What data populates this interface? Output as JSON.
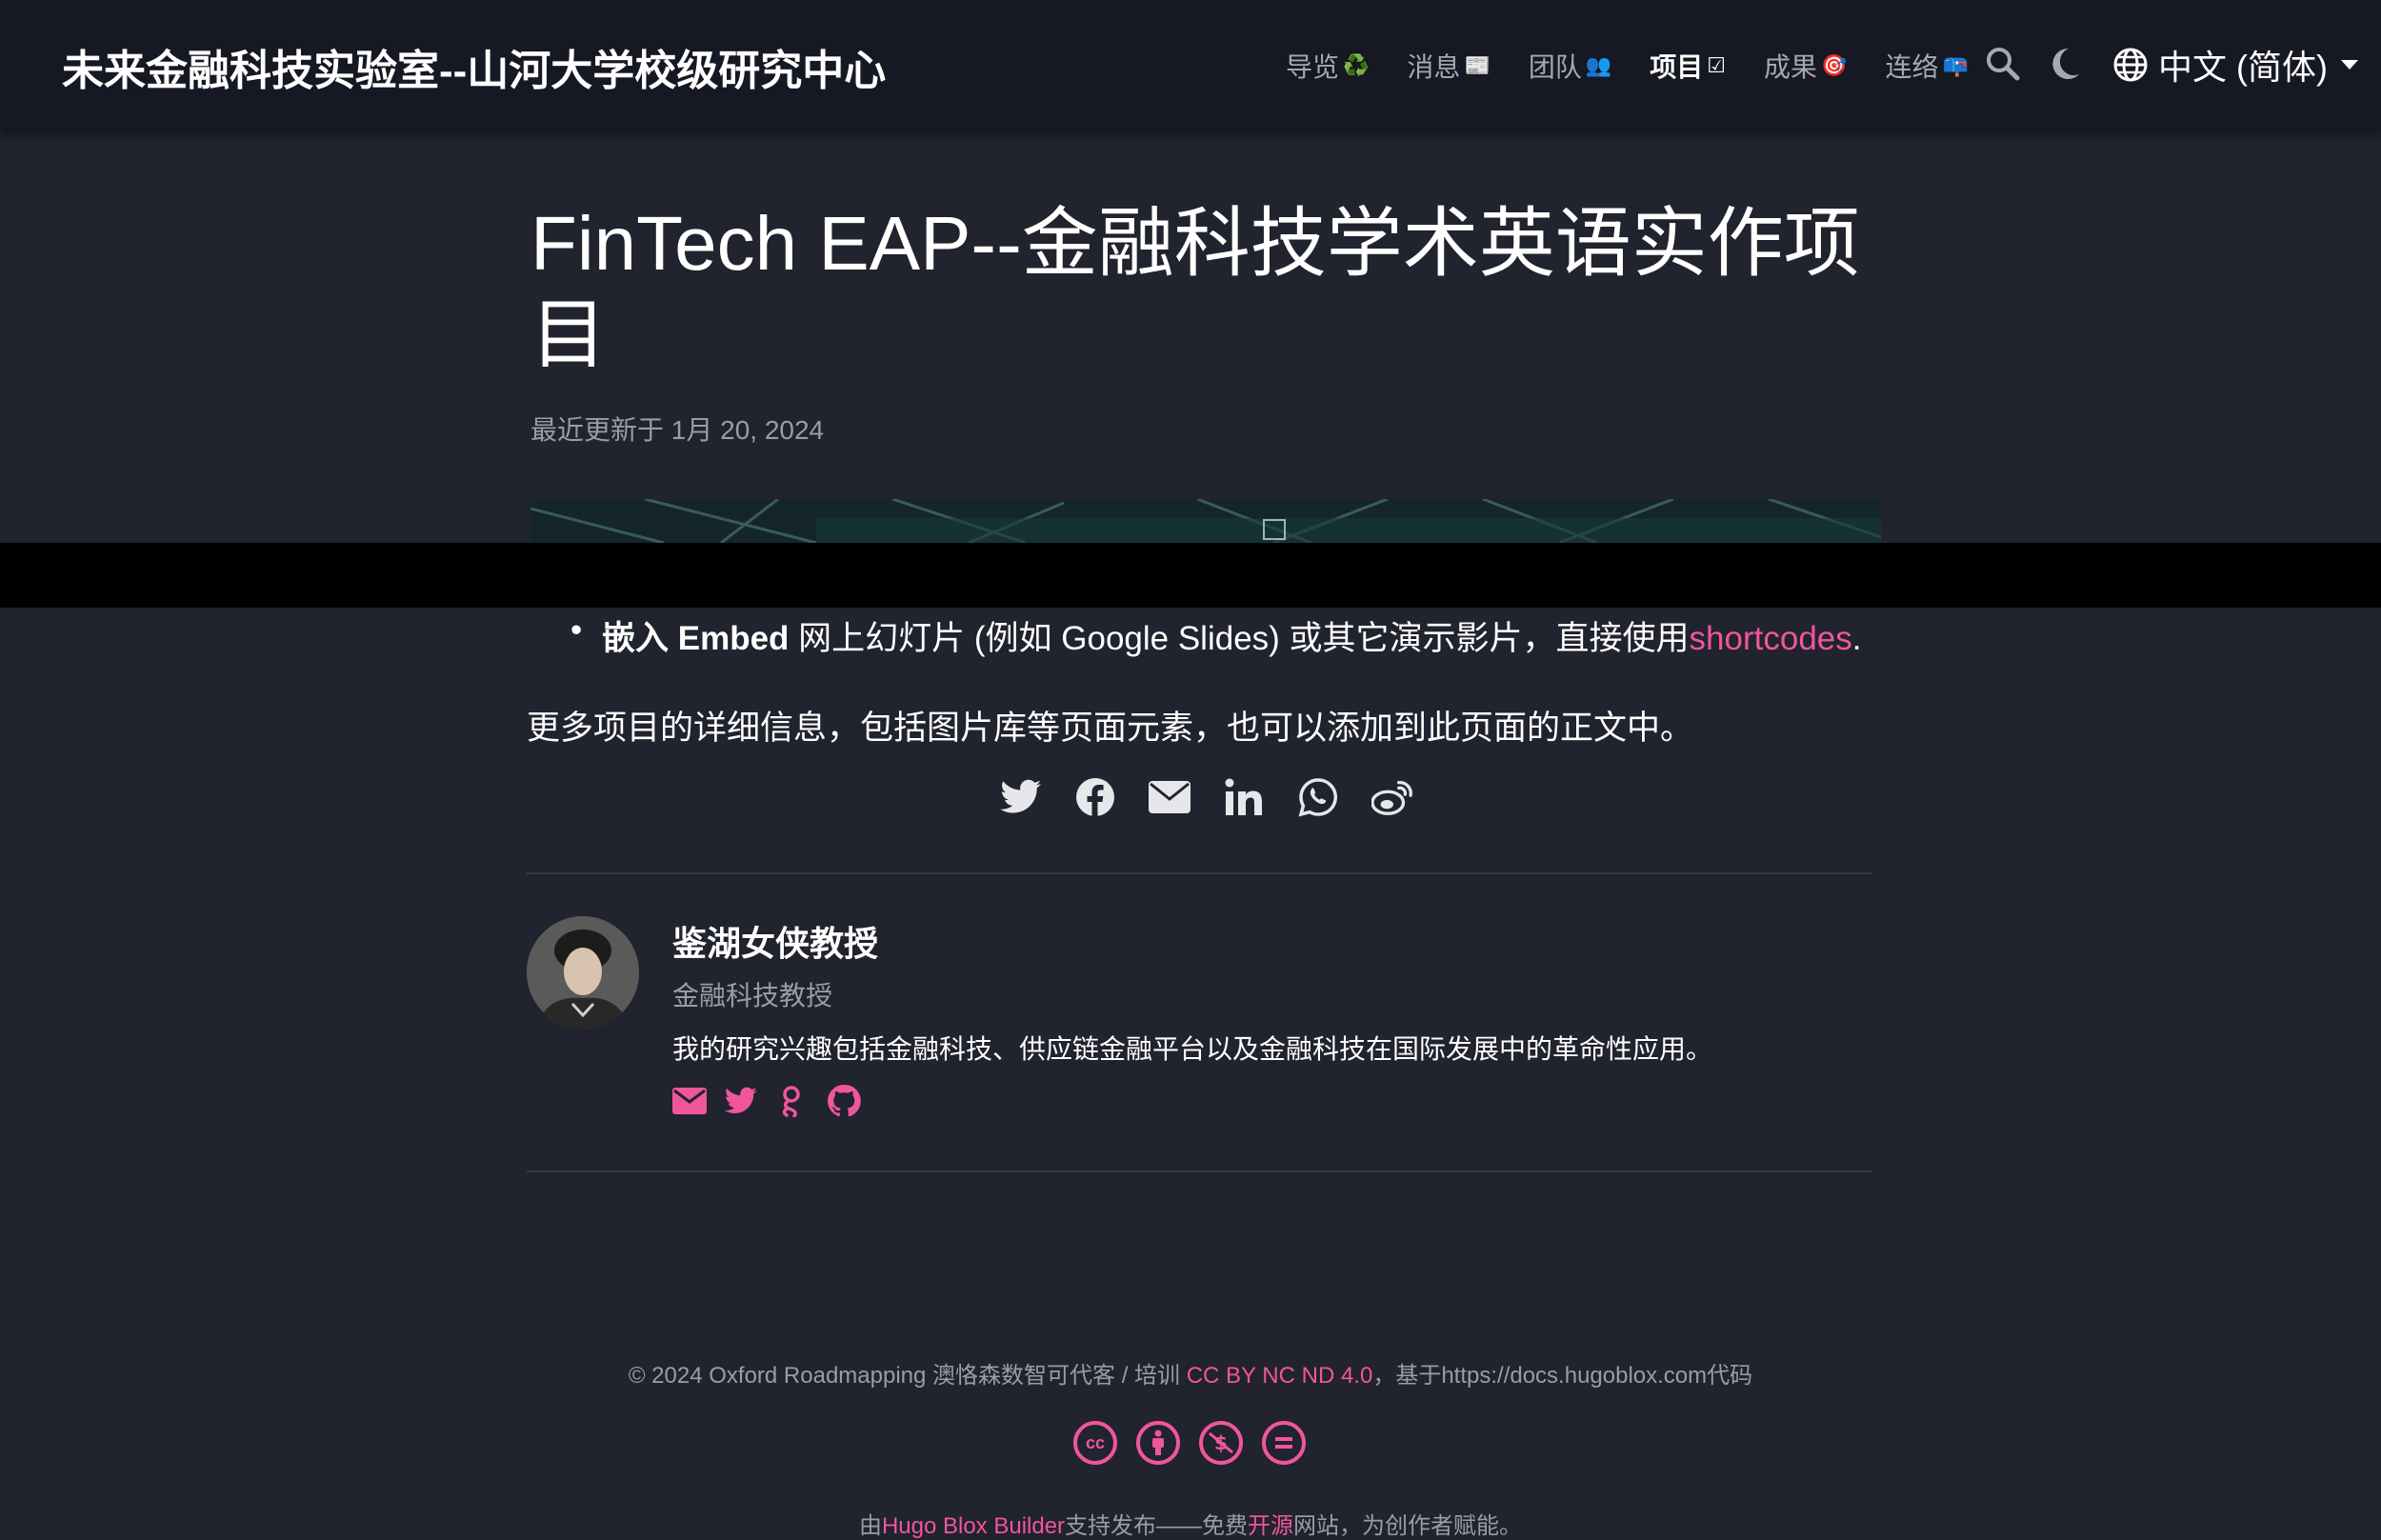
{
  "navbar": {
    "brand": "未来金融科技实验室--山河大学校级研究中心",
    "items": [
      {
        "label": "导览",
        "emoji": "♻️"
      },
      {
        "label": "消息",
        "emoji": "📰"
      },
      {
        "label": "团队",
        "emoji": "👥"
      },
      {
        "label": "项目",
        "emoji": "☑"
      },
      {
        "label": "成果",
        "emoji": "🎯"
      },
      {
        "label": "连络",
        "emoji": "📪"
      }
    ],
    "language": "中文 (简体)"
  },
  "article": {
    "title": "FinTech EAP--金融科技学术英语实作项目",
    "updated": "最近更新于 1月 20, 2024",
    "bullet_bold": "嵌入 Embed",
    "bullet_text": " 网上幻灯片 (例如 Google Slides) 或其它演示影片，直接使用",
    "bullet_link": "shortcodes",
    "bullet_end": ".",
    "paragraph": "更多项目的详细信息，包括图片库等页面元素，也可以添加到此页面的正文中。"
  },
  "share_icons": [
    "twitter-icon",
    "facebook-icon",
    "envelope-icon",
    "linkedin-icon",
    "whatsapp-icon",
    "weibo-icon"
  ],
  "author": {
    "name": "鉴湖女侠教授",
    "role": "金融科技教授",
    "bio": "我的研究兴趣包括金融科技、供应链金融平台以及金融科技在国际发展中的革命性应用。",
    "links": [
      "envelope-icon",
      "twitter-icon",
      "google-scholar-icon",
      "github-icon"
    ]
  },
  "footer": {
    "copyright": "© 2024 Oxford Roadmapping 澳恪森数智可代客 / 培训 ",
    "license_link": "CC BY NC ND 4.0",
    "copyright_tail": "，基于https://docs.hugoblox.com代码",
    "cc_icons": [
      "cc-icon",
      "by-icon",
      "nc-icon",
      "nd-icon"
    ],
    "powered_pre": "由",
    "powered_link": "Hugo Blox Builder",
    "powered_mid": "支持发布——免费",
    "powered_link2": "开源",
    "powered_tail": "网站，为创作者赋能。"
  },
  "colors": {
    "background": "#21232e",
    "navbar": "#161823",
    "accent": "#f0569b"
  }
}
